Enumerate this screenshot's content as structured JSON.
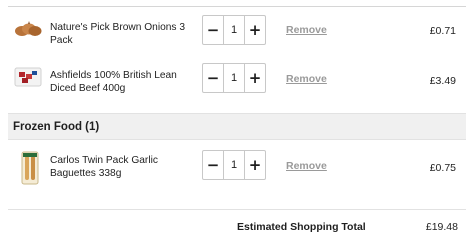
{
  "basket": {
    "items": [
      {
        "name": "Nature's Pick Brown Onions 3 Pack",
        "quantity": "1",
        "minus_label": "−",
        "plus_label": "+",
        "remove_label": "Remove",
        "price": "£0.71",
        "image_icon": "onions-product-image"
      },
      {
        "name": "Ashfields 100% British Lean Diced Beef 400g",
        "quantity": "1",
        "minus_label": "−",
        "plus_label": "+",
        "remove_label": "Remove",
        "price": "£3.49",
        "image_icon": "diced-beef-product-image"
      }
    ],
    "section": {
      "title": "Frozen Food (1)"
    },
    "frozen_items": [
      {
        "name": "Carlos Twin Pack Garlic Baguettes 338g",
        "quantity": "1",
        "minus_label": "−",
        "plus_label": "+",
        "remove_label": "Remove",
        "price": "£0.75",
        "image_icon": "garlic-baguettes-product-image"
      }
    ],
    "total": {
      "label": "Estimated Shopping Total",
      "value": "£19.48"
    }
  },
  "colors": {
    "remove_link": "#9a9a9a",
    "section_band": "#f0f0f0",
    "border": "#c8c8c8"
  }
}
